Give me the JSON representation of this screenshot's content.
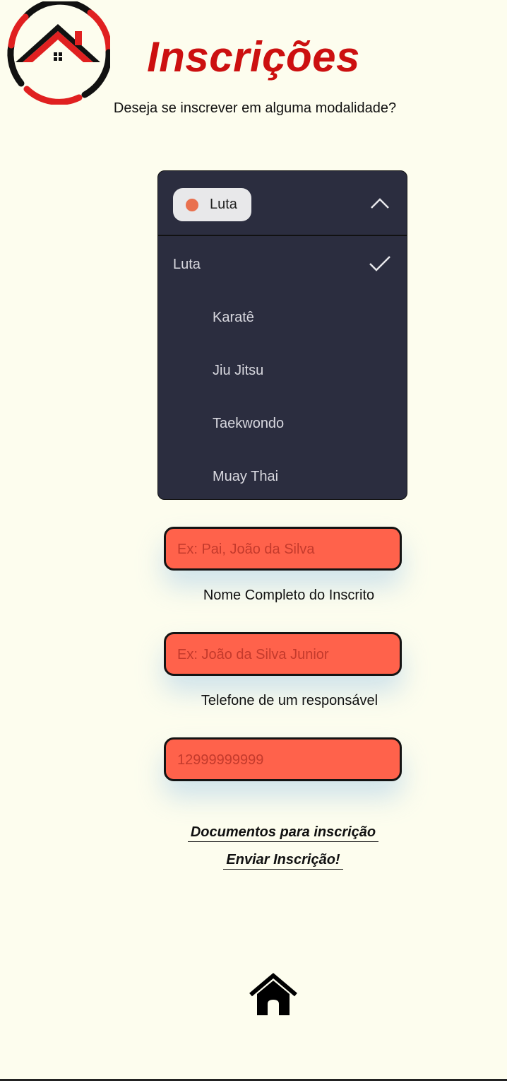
{
  "header": {
    "title": "Inscrições",
    "subtitle": "Deseja se inscrever em alguma modalidade?"
  },
  "dropdown": {
    "selected_label": "Luta",
    "selected_dot_color": "#e9704e",
    "options": [
      "Luta",
      "Karatê",
      "Jiu Jitsu",
      "Taekwondo",
      "Muay Thai"
    ],
    "checked_option": "Luta"
  },
  "form": {
    "field1_placeholder": "Ex: Pai, João da Silva",
    "field1_label": "Nome Completo do Inscrito",
    "field2_placeholder": "Ex: João da Silva Junior",
    "field2_label": "Telefone de um responsável",
    "field3_placeholder": "12999999999"
  },
  "links": {
    "documents": "Documentos para inscrição",
    "submit": "Enviar Inscrição!"
  },
  "nav": {
    "home_icon": "home-icon"
  },
  "colors": {
    "background": "#fdfdee",
    "title": "#cc1010",
    "dropdown_bg": "#2b2d3f",
    "input_bg": "#ff624b"
  }
}
